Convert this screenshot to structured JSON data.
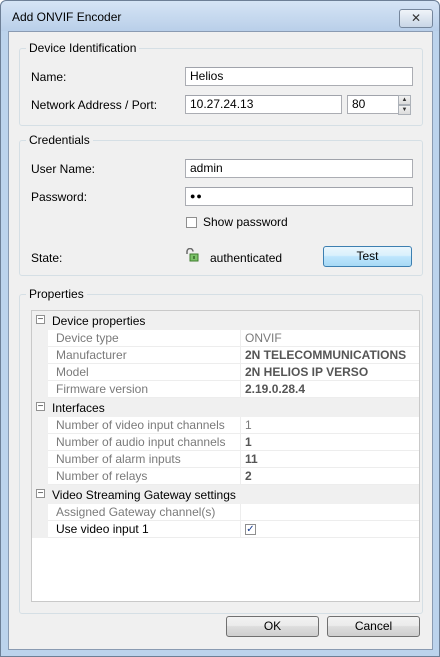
{
  "window": {
    "title": "Add ONVIF Encoder",
    "close_glyph": "✕"
  },
  "device_identification": {
    "group_label": "Device Identification",
    "name_label": "Name:",
    "name_value": "Helios",
    "address_label": "Network Address / Port:",
    "address_value": "10.27.24.13",
    "port_value": "80"
  },
  "credentials": {
    "group_label": "Credentials",
    "username_label": "User Name:",
    "username_value": "admin",
    "password_label": "Password:",
    "password_value": "●●",
    "show_password_label": "Show password",
    "show_password_checked": false,
    "state_label": "State:",
    "state_icon": "unlocked-padlock-icon",
    "state_value": "authenticated",
    "test_button": "Test"
  },
  "properties": {
    "group_label": "Properties",
    "categories": [
      {
        "label": "Device properties",
        "rows": [
          {
            "name": "Device type",
            "value": "ONVIF",
            "bold": false
          },
          {
            "name": "Manufacturer",
            "value": "2N TELECOMMUNICATIONS",
            "bold": true
          },
          {
            "name": "Model",
            "value": "2N HELIOS IP VERSO",
            "bold": true
          },
          {
            "name": "Firmware version",
            "value": "2.19.0.28.4",
            "bold": true
          }
        ]
      },
      {
        "label": "Interfaces",
        "rows": [
          {
            "name": "Number of video input channels",
            "value": "1",
            "bold": false
          },
          {
            "name": "Number of audio input channels",
            "value": "1",
            "bold": true
          },
          {
            "name": "Number of alarm inputs",
            "value": "11",
            "bold": true
          },
          {
            "name": "Number of relays",
            "value": "2",
            "bold": true
          }
        ]
      },
      {
        "label": "Video Streaming Gateway settings",
        "rows": [
          {
            "name": "Assigned Gateway channel(s)",
            "value": "",
            "bold": false
          },
          {
            "name": "Use video input 1",
            "value": "✓",
            "bold": false
          }
        ]
      }
    ],
    "collapse_glyph": "−"
  },
  "buttons": {
    "ok": "OK",
    "cancel": "Cancel"
  }
}
